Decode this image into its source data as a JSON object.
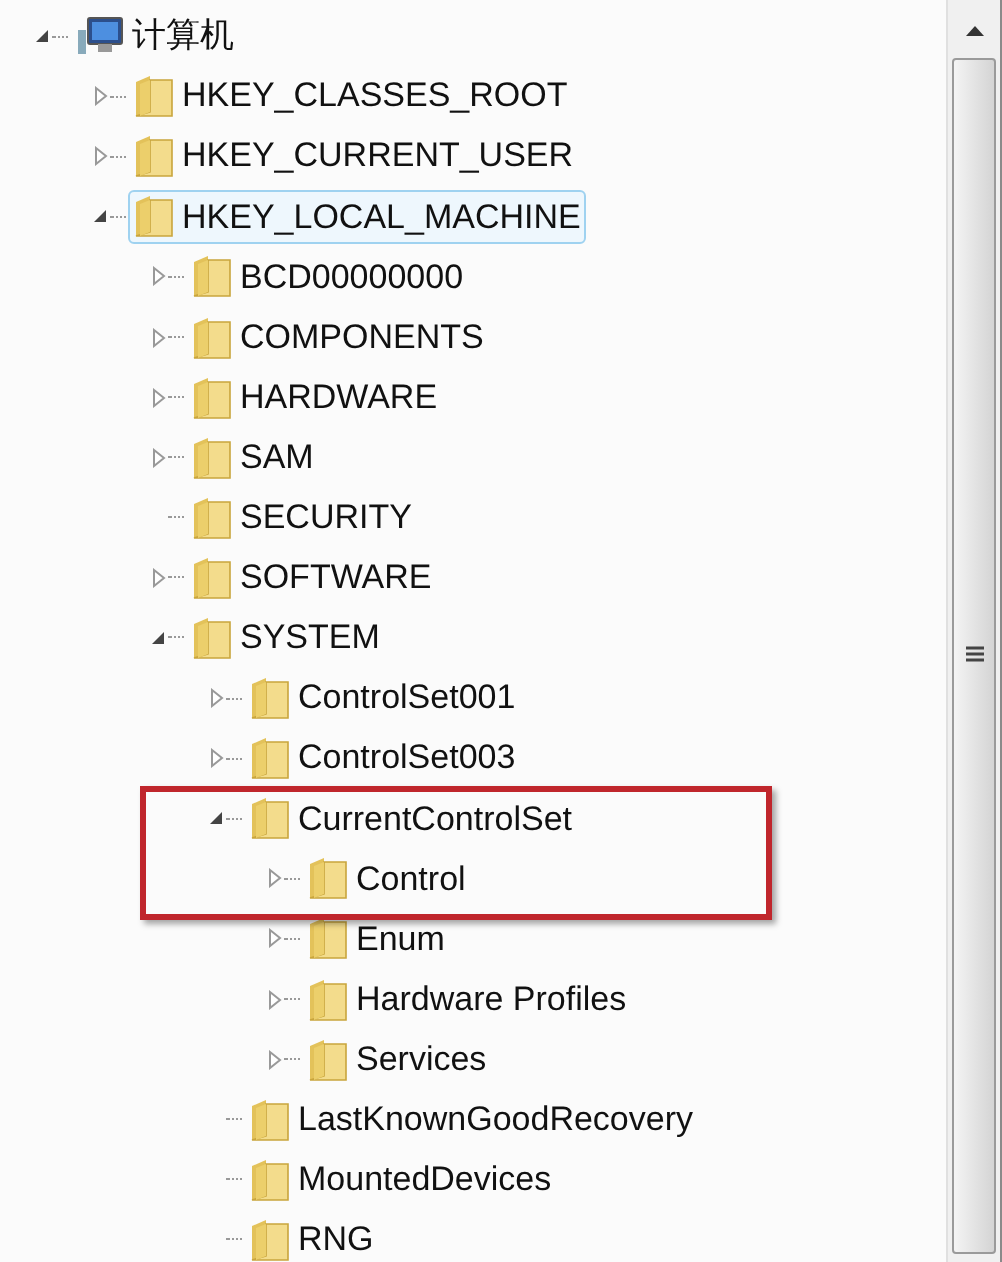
{
  "tree": [
    {
      "label": "计算机",
      "kind": "computer",
      "expanded": true,
      "selected": false,
      "children": [
        {
          "label": "HKEY_CLASSES_ROOT",
          "kind": "folder",
          "expanded": false,
          "selected": false
        },
        {
          "label": "HKEY_CURRENT_USER",
          "kind": "folder",
          "expanded": false,
          "selected": false
        },
        {
          "label": "HKEY_LOCAL_MACHINE",
          "kind": "folder",
          "expanded": true,
          "selected": true,
          "children": [
            {
              "label": "BCD00000000",
              "kind": "folder",
              "expanded": false,
              "selected": false
            },
            {
              "label": "COMPONENTS",
              "kind": "folder",
              "expanded": false,
              "selected": false
            },
            {
              "label": "HARDWARE",
              "kind": "folder",
              "expanded": false,
              "selected": false
            },
            {
              "label": "SAM",
              "kind": "folder",
              "expanded": false,
              "selected": false
            },
            {
              "label": "SECURITY",
              "kind": "folder",
              "selected": false
            },
            {
              "label": "SOFTWARE",
              "kind": "folder",
              "expanded": false,
              "selected": false
            },
            {
              "label": "SYSTEM",
              "kind": "folder",
              "expanded": true,
              "selected": false,
              "children": [
                {
                  "label": "ControlSet001",
                  "kind": "folder",
                  "expanded": false,
                  "selected": false
                },
                {
                  "label": "ControlSet003",
                  "kind": "folder",
                  "expanded": false,
                  "selected": false
                },
                {
                  "label": "CurrentControlSet",
                  "kind": "folder",
                  "expanded": true,
                  "selected": false,
                  "highlighted": true,
                  "children": [
                    {
                      "label": "Control",
                      "kind": "folder",
                      "expanded": false,
                      "selected": false,
                      "highlighted": true
                    },
                    {
                      "label": "Enum",
                      "kind": "folder",
                      "expanded": false,
                      "selected": false
                    },
                    {
                      "label": "Hardware Profiles",
                      "kind": "folder",
                      "expanded": false,
                      "selected": false
                    },
                    {
                      "label": "Services",
                      "kind": "folder",
                      "expanded": false,
                      "selected": false
                    }
                  ]
                },
                {
                  "label": "LastKnownGoodRecovery",
                  "kind": "folder",
                  "selected": false
                },
                {
                  "label": "MountedDevices",
                  "kind": "folder",
                  "selected": false
                },
                {
                  "label": "RNG",
                  "kind": "folder",
                  "selected": false
                }
              ]
            }
          ]
        }
      ]
    }
  ]
}
